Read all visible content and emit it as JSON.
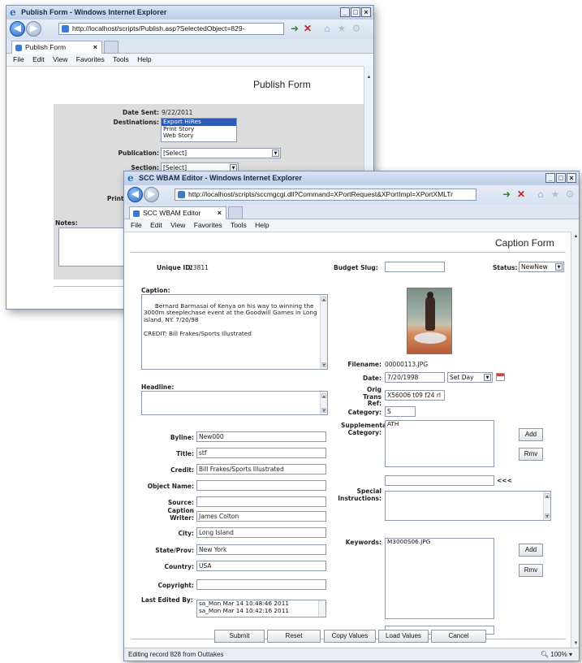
{
  "publish_window": {
    "title": "Publish Form - Windows Internet Explorer",
    "address": "http://localhost/scripts/Publish.asp?SelectedObject=829-",
    "tab_label": "Publish Form",
    "menu": [
      "File",
      "Edit",
      "View",
      "Favorites",
      "Tools",
      "Help"
    ],
    "form_title": "Publish Form",
    "date_sent_label": "Date Sent:",
    "date_sent_value": "9/22/2011",
    "destinations_label": "Destinations:",
    "destinations": [
      "Export HiRes",
      "Print Story",
      "Web Story"
    ],
    "publication_label": "Publication:",
    "publication_value": "[Select]",
    "section_label": "Section:",
    "section_value": "[Select]",
    "print_label": "Print I",
    "notes_label": "Notes:"
  },
  "caption_window": {
    "title": "SCC WBAM Editor - Windows Internet Explorer",
    "address": "http://localhost/scripts/sccmgcgi.dll?Command=XPortRequest&XPortImpl=XPortXMLTr",
    "tab_label": "SCC WBAM Editor",
    "menu": [
      "File",
      "Edit",
      "View",
      "Favorites",
      "Tools",
      "Help"
    ],
    "form_title": "Caption Form",
    "unique_id_label": "Unique ID:",
    "unique_id_value": "23811",
    "budget_slug_label": "Budget Slug:",
    "budget_slug_value": "",
    "status_label": "Status:",
    "status_value": "NewNew",
    "caption_label": "Caption:",
    "caption_text": "Bernard Barmasai of Kenya on his way to winning the 3000m steeplechase event at the Goodwill Games in Long Island, NY. 7/20/98\n\nCREDIT: Bill Frakes/Sports Illustrated",
    "headline_label": "Headline:",
    "headline_value": "",
    "byline_label": "Byline:",
    "byline_value": "New000",
    "title_label": "Title:",
    "title_value": "stf",
    "credit_label": "Credit:",
    "credit_value": "Bill Frakes/Sports Illustrated",
    "object_name_label": "Object Name:",
    "object_name_value": "",
    "source_label": "Source:",
    "source_value": "",
    "caption_writer_label": "Caption Writer:",
    "caption_writer_value": "James Colton",
    "city_label": "City:",
    "city_value": "Long Island",
    "state_label": "State/Prov:",
    "state_value": "New York",
    "country_label": "Country:",
    "country_value": "USA",
    "copyright_label": "Copyright:",
    "copyright_value": "",
    "last_edited_label": "Last Edited By:",
    "last_edited": [
      "sa_Mon Mar 14 10:48:46 2011",
      "sa_Mon Mar 14 10:42:16 2011"
    ],
    "filename_label": "Filename:",
    "filename_value": "00000113.JPG",
    "date_label": "Date:",
    "date_value": "7/20/1998",
    "set_day_value": "Set Day",
    "orig_trans_label": "Orig Trans Ref:",
    "orig_trans_value": "X56006 t09 f24 rl",
    "category_label": "Category:",
    "category_value": "S",
    "supp_category_label": "Supplemental Category:",
    "supp_category_items": [
      "ATH"
    ],
    "add_label": "Add",
    "rmv_label": "Rmv",
    "arrow_label": "<<<",
    "special_instructions_label": "Special Instructions:",
    "keywords_label": "Keywords:",
    "keywords_items": [
      "M3000S06.JPG"
    ],
    "buttons": {
      "submit": "Submit",
      "reset": "Reset",
      "copy": "Copy Values",
      "load": "Load Values",
      "cancel": "Cancel"
    },
    "status_bar": "Editing record 828 from Outtakes",
    "zoom": "100%"
  }
}
